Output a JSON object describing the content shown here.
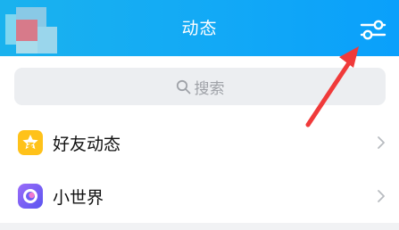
{
  "header": {
    "title": "动态",
    "background_color": "#12a9f6",
    "settings_icon": "filter-sliders-icon"
  },
  "search": {
    "placeholder": "搜索",
    "icon": "search-icon"
  },
  "menu": {
    "items": [
      {
        "label": "好友动态",
        "icon": "friends-feed-star-icon",
        "icon_color": "#ffc21a"
      },
      {
        "label": "小世界",
        "icon": "small-world-planet-icon",
        "icon_color": "#7b5cf5"
      }
    ]
  },
  "annotation": {
    "arrow_color": "#f03a3a"
  }
}
